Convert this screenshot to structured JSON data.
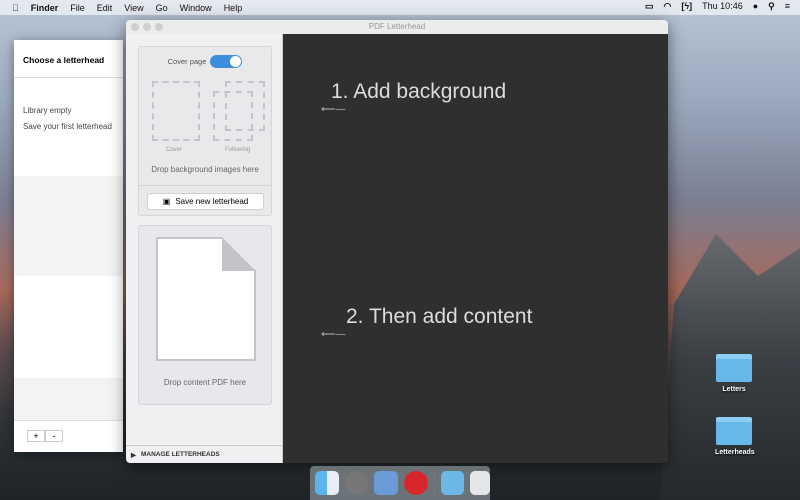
{
  "menubar": {
    "app": "Finder",
    "items": [
      "File",
      "Edit",
      "View",
      "Go",
      "Window",
      "Help"
    ],
    "clock": "Thu 10:46"
  },
  "library": {
    "title": "Choose a letterhead",
    "empty": "Library empty",
    "hint": "Save your first letterhead",
    "add": "+",
    "remove": "-"
  },
  "window": {
    "title": "PDF Letterhead"
  },
  "sidebar": {
    "cover_page_label": "Cover page",
    "cover_page_on": true,
    "cover_label": "Cover",
    "following_label": "Following",
    "drop_bg": "Drop background images here",
    "save_button": "Save new letterhead",
    "drop_content": "Drop content PDF here",
    "manage": "MANAGE LETTERHEADS"
  },
  "main": {
    "step1": "1. Add background",
    "step2": "2. Then add content"
  },
  "desktop": {
    "folders": [
      "Letters",
      "Letterheads"
    ]
  }
}
